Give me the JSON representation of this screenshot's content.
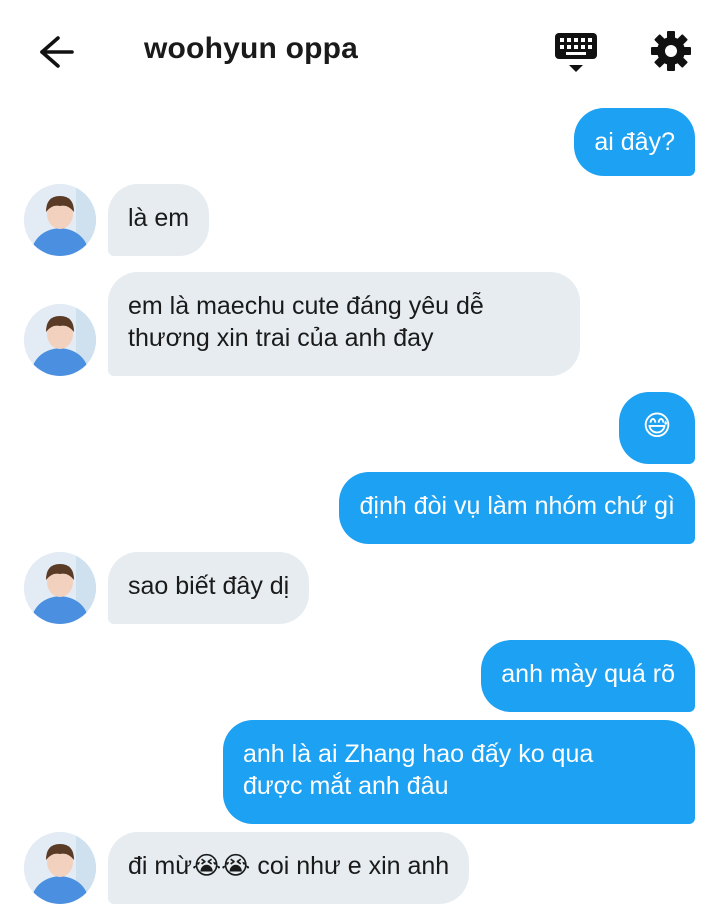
{
  "header": {
    "title": "woohyun oppa",
    "back_icon": "arrow-left-icon",
    "keyboard_icon": "keyboard-icon",
    "settings_icon": "gear-icon"
  },
  "colors": {
    "outgoing_bubble": "#1da1f2",
    "incoming_bubble": "#e6ecf0",
    "text_dark": "#1a1a1a"
  },
  "messages": [
    {
      "direction": "out",
      "text": "ai đây?"
    },
    {
      "direction": "in",
      "text": "là em"
    },
    {
      "direction": "in",
      "text": "em là maechu cute đáng yêu dễ\nthương xin trai của anh đay"
    },
    {
      "direction": "out",
      "text": "😅"
    },
    {
      "direction": "out",
      "text": "định đòi vụ làm nhóm chứ gì"
    },
    {
      "direction": "in",
      "text": "sao biết đây dị"
    },
    {
      "direction": "out",
      "text": "anh mày quá rõ"
    },
    {
      "direction": "out",
      "text": "anh là ai Zhang hao đấy ko qua\nđược mắt anh đâu"
    },
    {
      "direction": "in",
      "text": "đi mừ😭😭 coi như e xin anh"
    }
  ]
}
